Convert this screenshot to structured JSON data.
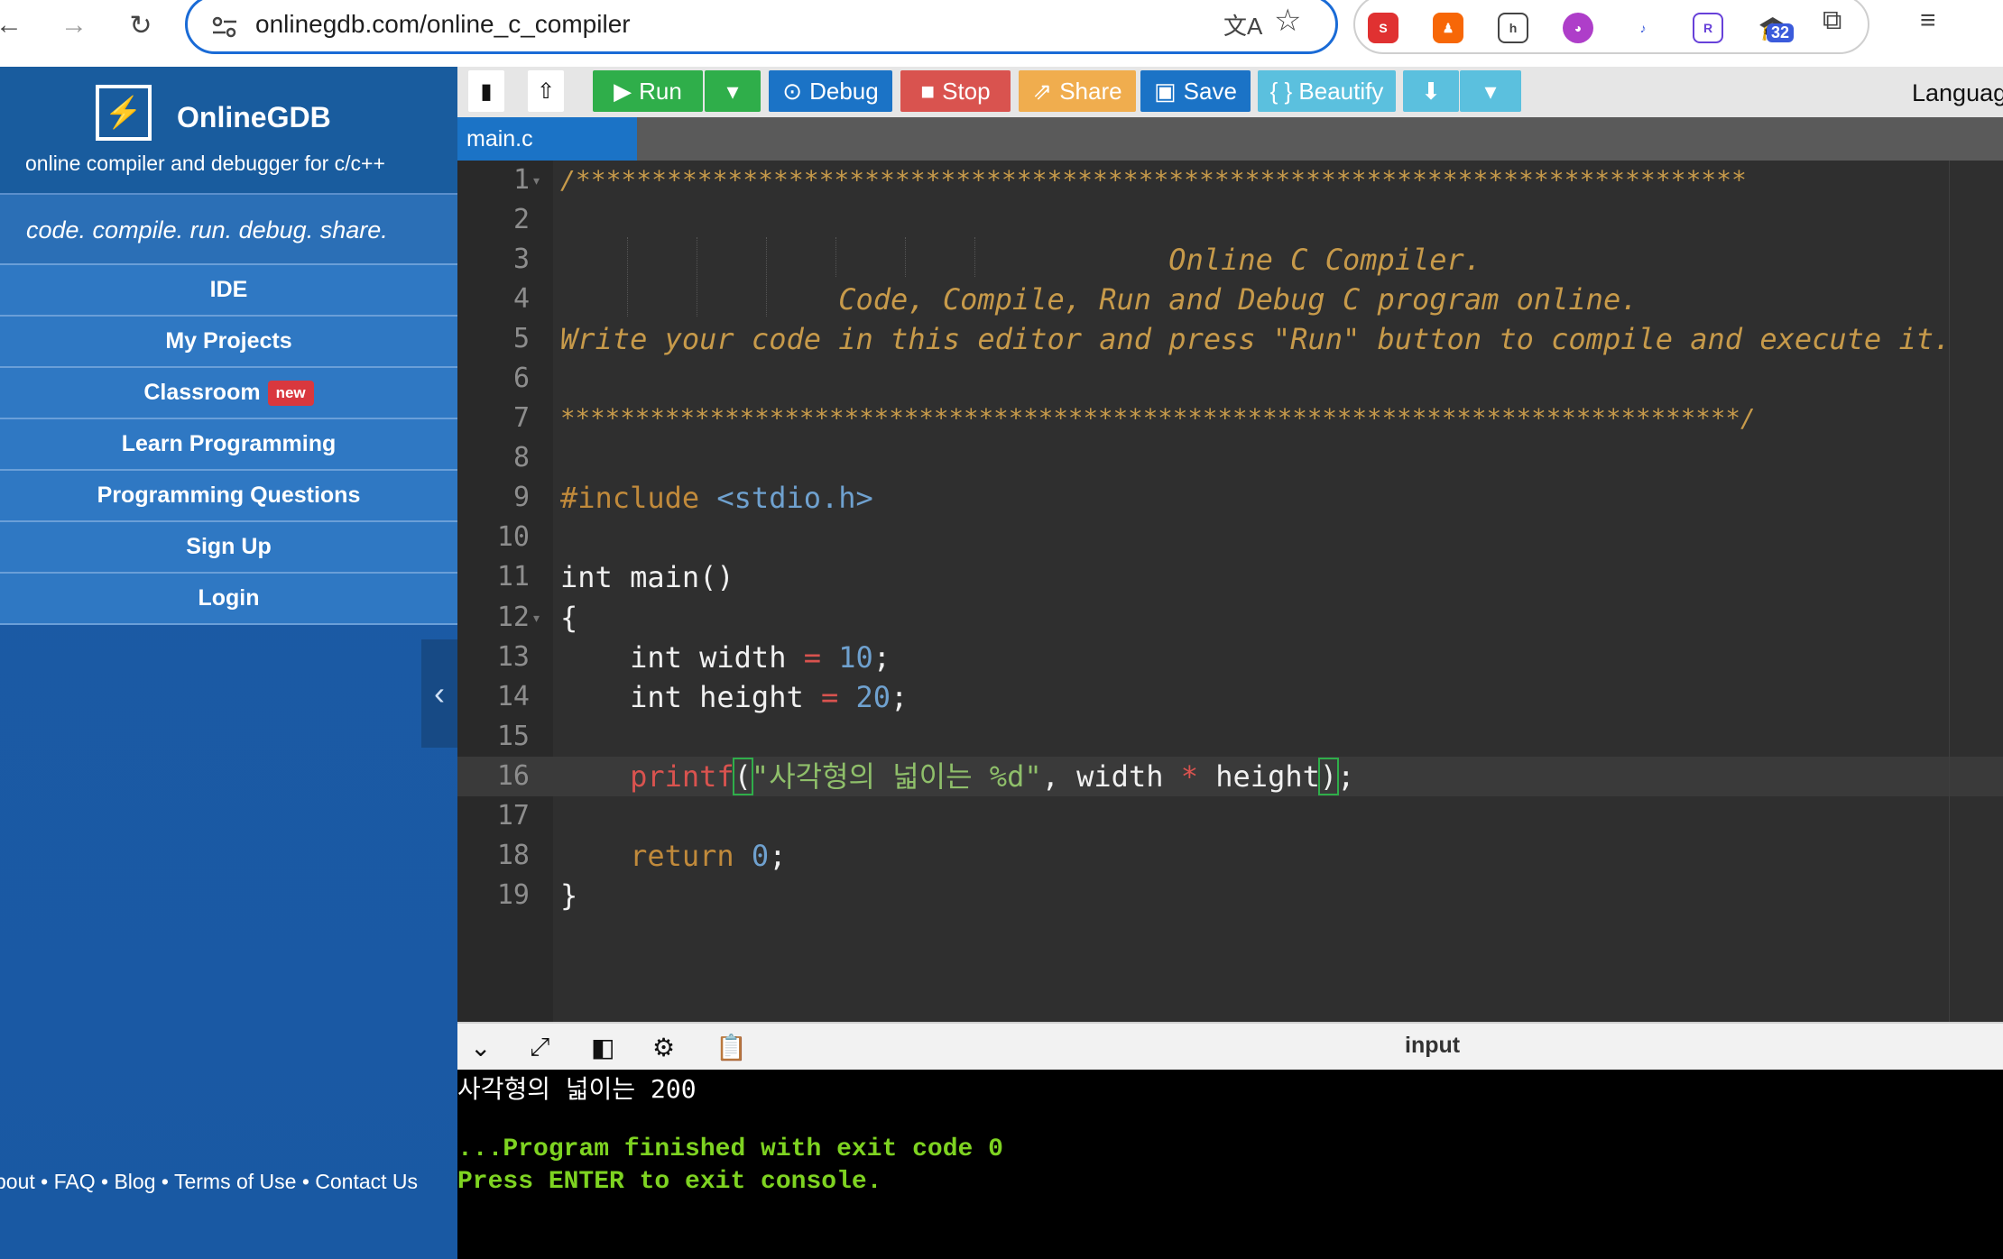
{
  "browser": {
    "url": "onlinegdb.com/online_c_compiler",
    "extension_badge": "32"
  },
  "brand": {
    "name": "OnlineGDB",
    "tagline": "online compiler and debugger for c/c++",
    "slogan": "code. compile. run. debug. share."
  },
  "nav": {
    "items": [
      "IDE",
      "My Projects",
      "Classroom",
      "Learn Programming",
      "Programming Questions",
      "Sign Up",
      "Login"
    ],
    "new_badge": "new"
  },
  "footer": {
    "links": [
      "bout",
      "FAQ",
      "Blog",
      "Terms of Use",
      "Contact Us"
    ],
    "separator": "•"
  },
  "toolbar": {
    "run": "Run",
    "debug": "Debug",
    "stop": "Stop",
    "share": "Share",
    "save": "Save",
    "beautify": "{ } Beautify",
    "language_label": "Languag"
  },
  "colors": {
    "run": "#2fae4a",
    "debug": "#1b73c6",
    "stop": "#d9534f",
    "share": "#f0ad4e",
    "save": "#1b73c6",
    "beautify": "#5bc0de",
    "download": "#5bc0de"
  },
  "editor": {
    "tab": "main.c",
    "line_numbers": [
      "1",
      "2",
      "3",
      "4",
      "5",
      "6",
      "7",
      "8",
      "9",
      "10",
      "11",
      "12",
      "13",
      "14",
      "15",
      "16",
      "17",
      "18",
      "19"
    ],
    "line1": "/*****************************************************************************",
    "line3": "                                   Online C Compiler.",
    "line4": "                Code, Compile, Run and Debug C program online.",
    "line5": "Write your code in this editor and press \"Run\" button to compile and execute it.",
    "line7": "*******************************************************************************/",
    "include_kw": "#include",
    "include_hdr": "<stdio.h>",
    "line11": "int main()",
    "line12": "{",
    "l13_a": "    int width ",
    "l13_op": "=",
    "l13_num": "10",
    "l13_end": ";",
    "l14_a": "    int height ",
    "l14_op": "=",
    "l14_num": "20",
    "l14_end": ";",
    "l16_indent": "    ",
    "l16_fn": "printf",
    "l16_paren": "(",
    "l16_str": "\"사각형의 넓이는 %d\"",
    "l16_mid": ", width ",
    "l16_op": "*",
    "l16_var": " height",
    "l16_close": ")",
    "l16_end": ";",
    "l18_indent": "    ",
    "l18_kw": "return",
    "l18_num": "0",
    "l18_end": ";",
    "line19": "}"
  },
  "console": {
    "input_label": "input",
    "output": "사각형의 넓이는 200",
    "finished": "...Program finished with exit code 0",
    "press_enter": "Press ENTER to exit console."
  }
}
